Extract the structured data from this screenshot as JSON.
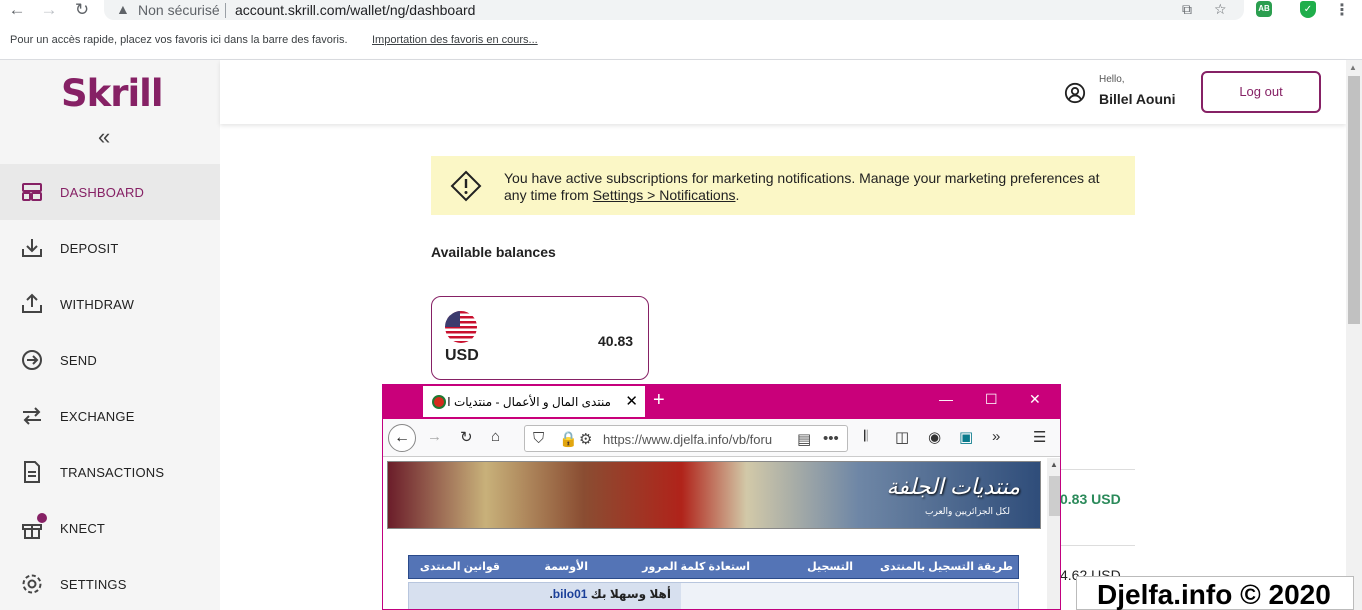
{
  "browser": {
    "not_secure": "Non sécurisé",
    "url": "account.skrill.com/wallet/ng/dashboard",
    "ext_ab": "AB",
    "bookmark_hint": "Pour un accès rapide, placez vos favoris ici dans la barre des favoris.",
    "bookmark_link": "Importation des favoris en cours..."
  },
  "brand": {
    "logo": "Skrill",
    "accent": "#862165"
  },
  "sidebar": {
    "items": [
      {
        "label": "DASHBOARD",
        "icon": "dashboard-icon"
      },
      {
        "label": "DEPOSIT",
        "icon": "deposit-icon"
      },
      {
        "label": "WITHDRAW",
        "icon": "withdraw-icon"
      },
      {
        "label": "SEND",
        "icon": "send-icon"
      },
      {
        "label": "EXCHANGE",
        "icon": "exchange-icon"
      },
      {
        "label": "TRANSACTIONS",
        "icon": "transactions-icon"
      },
      {
        "label": "KNECT",
        "icon": "gift-icon"
      },
      {
        "label": "SETTINGS",
        "icon": "gear-icon"
      }
    ]
  },
  "header": {
    "hello": "Hello,",
    "username": "Billel Aouni",
    "logout": "Log out"
  },
  "notice": {
    "text": "You have active subscriptions for marketing notifications. Manage your marketing preferences at any time from ",
    "link": "Settings > Notifications",
    "end": "."
  },
  "balances": {
    "title": "Available balances",
    "card": {
      "currency": "USD",
      "amount": "40.83"
    },
    "right_amount_1": "0.83 USD",
    "right_amount_2": "4.62 USD",
    "positive_color": "#2b8a5a"
  },
  "overlay": {
    "tab_title": "منتدى المال و الأعمال - منتديات ا",
    "url": "https://www.djelfa.info/vb/foru",
    "banner_logo": "منتديات الجلفة",
    "banner_sub": "لكل الجزائريين والعرب",
    "forum_nav": [
      "طريقة التسجيل بالمنتدى",
      "التسجيل",
      "استعادة كلمة المرور",
      "الأوسمة",
      "قوانين المنتدى"
    ],
    "welcome_prefix": "أهلا وسهلا بك ",
    "welcome_user": "bilo01",
    "welcome_suffix": "."
  },
  "watermark": "Djelfa.info © 2020"
}
